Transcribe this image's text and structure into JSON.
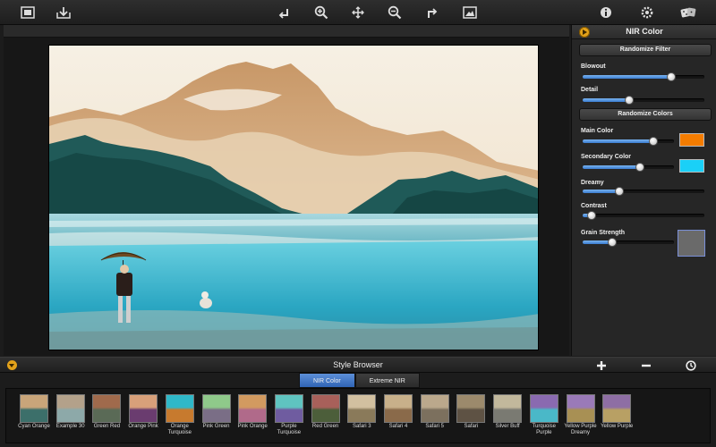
{
  "panel": {
    "title": "NIR Color",
    "randomize_filter": "Randomize Filter",
    "randomize_colors": "Randomize Colors",
    "sliders": [
      {
        "label": "Blowout",
        "value": 0.73
      },
      {
        "label": "Detail",
        "value": 0.38
      },
      {
        "label": "Main Color",
        "value": 0.77
      },
      {
        "label": "Secondary Color",
        "value": 0.63
      },
      {
        "label": "Dreamy",
        "value": 0.3
      },
      {
        "label": "Contrast",
        "value": 0.07
      },
      {
        "label": "Grain Strength",
        "value": 0.32
      }
    ],
    "main_color": "#f47c00",
    "secondary_color": "#1ad0f7",
    "grain_color": "#6a6a6a"
  },
  "style_browser": {
    "title": "Style Browser",
    "tabs": [
      "NIR Color",
      "Extreme NIR"
    ],
    "active_tab": 0,
    "presets": [
      "Cyan Orange",
      "Example 30",
      "Green Red",
      "Orange Pink",
      "Orange Turquoise",
      "Pink Green",
      "Pink Orange",
      "Purple Turquoise",
      "Red Green",
      "Safari 3",
      "Safari 4",
      "Safari 5",
      "Safari",
      "Silver Buff",
      "Turquoise Purple",
      "Yellow Purple Dreamy",
      "Yellow Purple"
    ]
  },
  "toolbar": {
    "icons": [
      "compare-icon",
      "save-icon",
      "undo-icon",
      "zoom-in-icon",
      "pan-icon",
      "zoom-out-icon",
      "redo-icon",
      "fit-icon",
      "info-icon",
      "settings-icon",
      "dice-icon"
    ]
  },
  "accent_color": "#3a7cd0"
}
